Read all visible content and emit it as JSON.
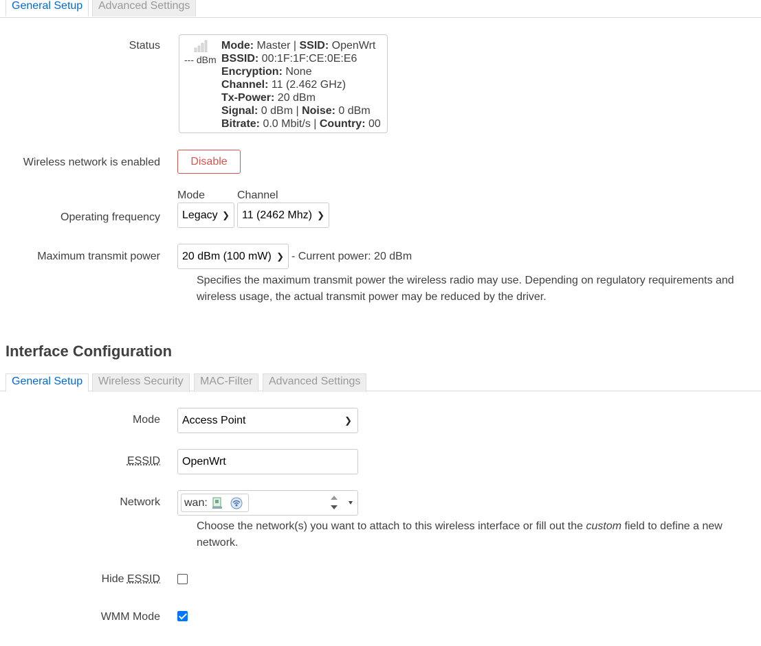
{
  "device_tabs": [
    {
      "label": "General Setup",
      "active": true
    },
    {
      "label": "Advanced Settings",
      "active": false
    }
  ],
  "status": {
    "label": "Status",
    "signal_text": "--- dBm",
    "lines": [
      [
        {
          "k": "Mode:",
          "v": " Master | "
        },
        {
          "k": "SSID:",
          "v": " OpenWrt"
        }
      ],
      [
        {
          "k": "BSSID:",
          "v": " 00:1F:1F:CE:0E:E6"
        }
      ],
      [
        {
          "k": "Encryption:",
          "v": " None"
        }
      ],
      [
        {
          "k": "Channel:",
          "v": " 11 (2.462 GHz)"
        }
      ],
      [
        {
          "k": "Tx-Power:",
          "v": " 20 dBm"
        }
      ],
      [
        {
          "k": "Signal:",
          "v": " 0 dBm | "
        },
        {
          "k": "Noise:",
          "v": " 0 dBm"
        }
      ],
      [
        {
          "k": "Bitrate:",
          "v": " 0.0 Mbit/s | "
        },
        {
          "k": "Country:",
          "v": " 00"
        }
      ]
    ]
  },
  "wireless_enabled": {
    "label": "Wireless network is enabled",
    "button": "Disable"
  },
  "operating_frequency": {
    "label": "Operating frequency",
    "mode_header": "Mode",
    "channel_header": "Channel",
    "mode_value": "Legacy",
    "channel_value": "11 (2462 Mhz)"
  },
  "transmit_power": {
    "label": "Maximum transmit power",
    "value": "20 dBm (100 mW)",
    "current": "- Current power: 20 dBm",
    "description": "Specifies the maximum transmit power the wireless radio may use. Depending on regulatory requirements and wireless usage, the actual transmit power may be reduced by the driver."
  },
  "interface_config": {
    "title": "Interface Configuration",
    "tabs": [
      {
        "label": "General Setup",
        "active": true
      },
      {
        "label": "Wireless Security",
        "active": false
      },
      {
        "label": "MAC-Filter",
        "active": false
      },
      {
        "label": "Advanced Settings",
        "active": false
      }
    ],
    "mode_label": "Mode",
    "mode_value": "Access Point",
    "essid_label": "ESSID",
    "essid_value": "OpenWrt",
    "network_label": "Network",
    "network_value": "wan:",
    "network_desc_1": "Choose the network(s) you want to attach to this wireless interface or fill out the ",
    "network_desc_em": "custom",
    "network_desc_2": " field to define a new network.",
    "hide_essid_label_prefix": "Hide ",
    "hide_essid_label_abbr": "ESSID",
    "hide_essid_checked": false,
    "wmm_label": "WMM Mode",
    "wmm_checked": true
  },
  "colors": {
    "accent": "#0069d6",
    "danger": "#d9534f",
    "checkbox": "#0075ff"
  }
}
